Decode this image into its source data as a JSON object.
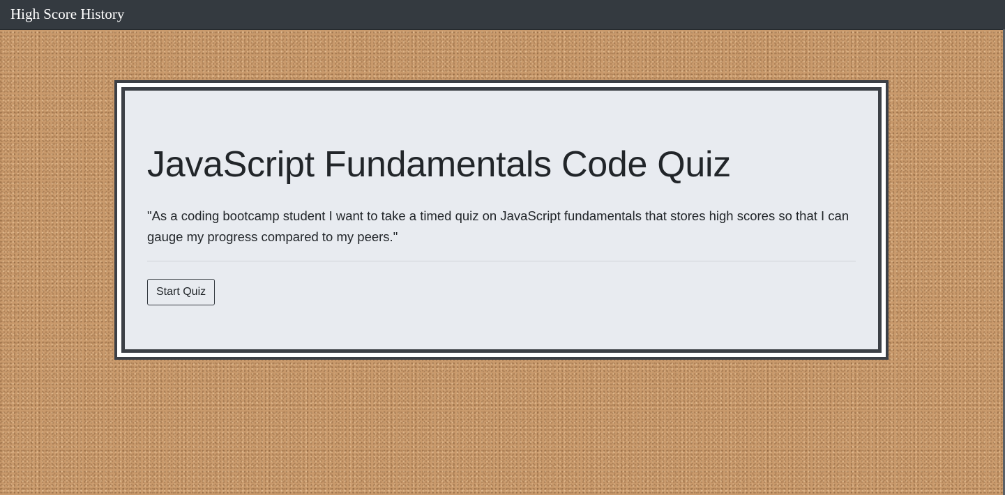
{
  "navbar": {
    "link_label": "High Score History"
  },
  "jumbotron": {
    "title": "JavaScript Fundamentals Code Quiz",
    "lead": "\"As a coding bootcamp student I want to take a timed quiz on JavaScript fundamentals that stores high scores so that I can gauge my progress compared to my peers.\"",
    "button_label": "Start Quiz"
  },
  "colors": {
    "navbar_bg": "#343a40",
    "card_bg": "#e8ebf0",
    "border": "#3c4046",
    "background_cork": "#c99a6c"
  }
}
